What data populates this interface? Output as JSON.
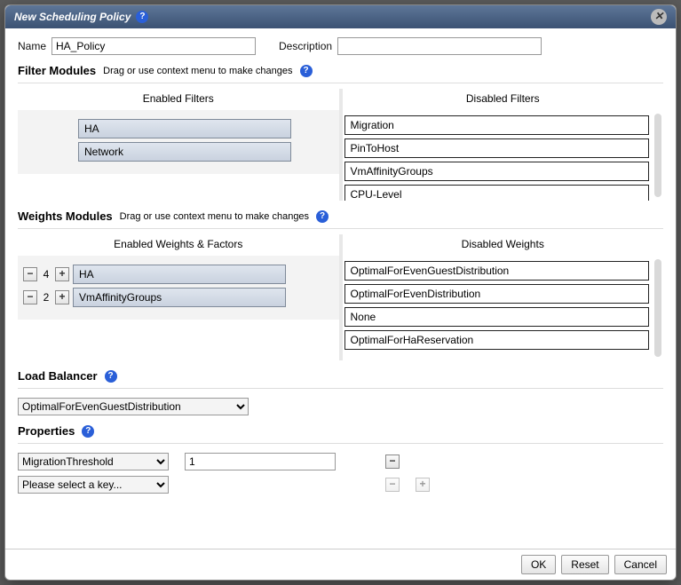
{
  "dialog": {
    "title": "New Scheduling Policy"
  },
  "form": {
    "name_label": "Name",
    "name_value": "HA_Policy",
    "desc_label": "Description",
    "desc_value": ""
  },
  "filters": {
    "heading": "Filter Modules",
    "hint": "Drag or use context menu to make changes",
    "enabled_title": "Enabled Filters",
    "disabled_title": "Disabled Filters",
    "enabled": [
      "HA",
      "Network"
    ],
    "disabled": [
      "Migration",
      "PinToHost",
      "VmAffinityGroups",
      "CPU-Level"
    ]
  },
  "weights": {
    "heading": "Weights Modules",
    "hint": "Drag or use context menu to make changes",
    "enabled_title": "Enabled Weights & Factors",
    "disabled_title": "Disabled Weights",
    "enabled": [
      {
        "factor": "4",
        "name": "HA"
      },
      {
        "factor": "2",
        "name": "VmAffinityGroups"
      }
    ],
    "disabled": [
      "OptimalForEvenGuestDistribution",
      "OptimalForEvenDistribution",
      "None",
      "OptimalForHaReservation"
    ]
  },
  "load_balancer": {
    "heading": "Load Balancer",
    "value": "OptimalForEvenGuestDistribution"
  },
  "properties": {
    "heading": "Properties",
    "rows": [
      {
        "key": "MigrationThreshold",
        "value": "1",
        "has_value": true,
        "can_remove": true,
        "can_add": false
      },
      {
        "key": "Please select a key...",
        "value": "",
        "has_value": false,
        "can_remove": false,
        "can_add": false
      }
    ]
  },
  "buttons": {
    "ok": "OK",
    "reset": "Reset",
    "cancel": "Cancel"
  }
}
